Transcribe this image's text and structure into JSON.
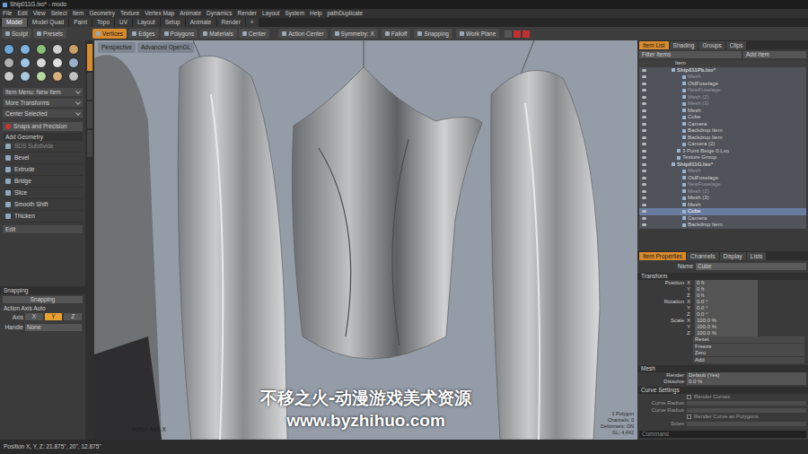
{
  "window": {
    "title": "Ship011G.lxo* - modo"
  },
  "menu": [
    "File",
    "Edit",
    "View",
    "Select",
    "Item",
    "Geometry",
    "Texture",
    "Vertex Map",
    "Animate",
    "Dynamics",
    "Render",
    "Layout",
    "System",
    "Help",
    "pathDuplicate"
  ],
  "layout_tabs": [
    {
      "label": "Model",
      "selected": true
    },
    {
      "label": "Model Quad",
      "selected": false
    },
    {
      "label": "Paint",
      "selected": false
    },
    {
      "label": "Topo",
      "selected": false
    },
    {
      "label": "UV",
      "selected": false
    },
    {
      "label": "Layout",
      "selected": false
    },
    {
      "label": "Setup",
      "selected": false
    },
    {
      "label": "Animate",
      "selected": false
    },
    {
      "label": "Render",
      "selected": false
    },
    {
      "label": "+",
      "selected": false
    }
  ],
  "toolbar": {
    "left": [
      "Sculpt",
      "Presets"
    ],
    "modes": [
      {
        "label": "Vertices",
        "selected": true
      },
      {
        "label": "Edges",
        "selected": false
      },
      {
        "label": "Polygons",
        "selected": false
      },
      {
        "label": "Materials",
        "selected": false
      },
      {
        "label": "Center",
        "selected": false
      }
    ],
    "options": [
      "Action Center",
      "Symmetry: X",
      "Falloff",
      "Snapping",
      "Work Plane"
    ]
  },
  "left_panel": {
    "dropdowns": [
      "Item Menu: New Item",
      "More Transforms",
      "Center Selected"
    ],
    "snaps_button": "Snaps and Precision",
    "add_geometry": "Add Geometry",
    "tools": [
      {
        "label": "SDS Subdivide",
        "disabled": true
      },
      {
        "label": "Bevel",
        "disabled": false
      },
      {
        "label": "Extrude",
        "disabled": false
      },
      {
        "label": "Bridge",
        "disabled": false
      },
      {
        "label": "Slice",
        "disabled": false
      },
      {
        "label": "Smooth Shift",
        "disabled": false
      },
      {
        "label": "Thicken",
        "disabled": false
      }
    ],
    "edit_dropdown": "Edit",
    "snapping": {
      "title": "Snapping",
      "field": "Snapping",
      "action_axis": "Action Axis Auto",
      "axis_label": "Axis",
      "axes": [
        {
          "label": "X",
          "selected": false
        },
        {
          "label": "Y",
          "selected": true
        },
        {
          "label": "Z",
          "selected": false
        }
      ],
      "handle_label": "Handle",
      "handle_value": "None"
    }
  },
  "viewport": {
    "tabs": [
      "Perspective",
      "Advanced OpenGL"
    ],
    "axis_label": "Action Axis X",
    "stats": [
      "1 Polygon",
      "Channels: 0",
      "Deformers: ON",
      "GL: 4,442"
    ]
  },
  "watermark": {
    "line1": "不移之火-动漫游戏美术资源",
    "line2": "www.byzhihuo.com"
  },
  "item_list": {
    "tabs": [
      {
        "label": "Item List",
        "selected": true
      },
      {
        "label": "Shading",
        "selected": false
      },
      {
        "label": "Groups",
        "selected": false
      },
      {
        "label": "Clips",
        "selected": false
      }
    ],
    "filter": "Filter Items",
    "add_item": "Add Item",
    "header": "Item",
    "rows": [
      {
        "label": "Ship011Pb.lxo*",
        "depth": 0,
        "dimmed": false,
        "selected": false,
        "bold": true
      },
      {
        "label": "Mesh",
        "depth": 2,
        "dimmed": true,
        "selected": false,
        "bold": false
      },
      {
        "label": "OldFuselage",
        "depth": 2,
        "dimmed": false,
        "selected": false,
        "bold": false
      },
      {
        "label": "NewFuselage",
        "depth": 2,
        "dimmed": true,
        "selected": false,
        "bold": false
      },
      {
        "label": "Mesh (2)",
        "depth": 2,
        "dimmed": true,
        "selected": false,
        "bold": false
      },
      {
        "label": "Mesh (3)",
        "depth": 2,
        "dimmed": true,
        "selected": false,
        "bold": false
      },
      {
        "label": "Mesh",
        "depth": 2,
        "dimmed": false,
        "selected": false,
        "bold": false
      },
      {
        "label": "Cube",
        "depth": 2,
        "dimmed": false,
        "selected": false,
        "bold": false
      },
      {
        "label": "Camera",
        "depth": 2,
        "dimmed": false,
        "selected": false,
        "bold": false
      },
      {
        "label": "Backdrop Item",
        "depth": 2,
        "dimmed": false,
        "selected": false,
        "bold": false
      },
      {
        "label": "Backdrop Item",
        "depth": 2,
        "dimmed": false,
        "selected": false,
        "bold": false
      },
      {
        "label": "Camera (2)",
        "depth": 2,
        "dimmed": false,
        "selected": false,
        "bold": false
      },
      {
        "label": "3 Point Beige 0.Lxo",
        "depth": 1,
        "dimmed": false,
        "selected": false,
        "bold": false
      },
      {
        "label": "Texture Group",
        "depth": 1,
        "dimmed": false,
        "selected": false,
        "bold": false
      },
      {
        "label": "Ship011G.lxo*",
        "depth": 0,
        "dimmed": false,
        "selected": false,
        "bold": true
      },
      {
        "label": "Mesh",
        "depth": 2,
        "dimmed": true,
        "selected": false,
        "bold": false
      },
      {
        "label": "OldFuselage",
        "depth": 2,
        "dimmed": false,
        "selected": false,
        "bold": false
      },
      {
        "label": "NewFuselage",
        "depth": 2,
        "dimmed": true,
        "selected": false,
        "bold": false
      },
      {
        "label": "Mesh (2)",
        "depth": 2,
        "dimmed": true,
        "selected": false,
        "bold": false
      },
      {
        "label": "Mesh (3)",
        "depth": 2,
        "dimmed": false,
        "selected": false,
        "bold": false
      },
      {
        "label": "Mesh",
        "depth": 2,
        "dimmed": false,
        "selected": false,
        "bold": false
      },
      {
        "label": "Cube",
        "depth": 2,
        "dimmed": false,
        "selected": true,
        "bold": false
      },
      {
        "label": "Camera",
        "depth": 2,
        "dimmed": false,
        "selected": false,
        "bold": false
      },
      {
        "label": "Backdrop Item",
        "depth": 2,
        "dimmed": false,
        "selected": false,
        "bold": false
      }
    ]
  },
  "properties": {
    "tabs": [
      {
        "label": "Item Properties",
        "selected": true
      },
      {
        "label": "Channels",
        "selected": false
      },
      {
        "label": "Display",
        "selected": false
      },
      {
        "label": "Lists",
        "selected": false
      }
    ],
    "name_label": "Name",
    "name_value": "Cube",
    "transform_title": "Transform",
    "transform": [
      {
        "group": "Position",
        "rows": [
          {
            "axis": "X",
            "value": "0 ft"
          },
          {
            "axis": "Y",
            "value": "0 ft"
          },
          {
            "axis": "Z",
            "value": "0 ft"
          }
        ]
      },
      {
        "group": "Rotation",
        "rows": [
          {
            "axis": "X",
            "value": "0.0 °"
          },
          {
            "axis": "Y",
            "value": "0.0 °"
          },
          {
            "axis": "Z",
            "value": "0.0 °"
          }
        ]
      },
      {
        "group": "Scale",
        "rows": [
          {
            "axis": "X",
            "value": "100.0 %"
          },
          {
            "axis": "Y",
            "value": "100.0 %"
          },
          {
            "axis": "Z",
            "value": "100.0 %"
          }
        ]
      }
    ],
    "transform_menus": [
      "Reset",
      "Freeze",
      "Zero",
      "Add"
    ],
    "mesh_title": "Mesh",
    "mesh": [
      {
        "label": "Render",
        "value": "Default (Yes)"
      },
      {
        "label": "Dissolve",
        "value": "0.0 %"
      }
    ],
    "curve_title": "Curve Settings",
    "curve": [
      {
        "label": "Render Curves",
        "kind": "check",
        "value": ""
      },
      {
        "label": "Curve Radius",
        "kind": "field",
        "value": ""
      },
      {
        "label": "Curve Radius",
        "kind": "field",
        "value": ""
      },
      {
        "label": "Render Curve as Polygons",
        "kind": "check",
        "value": ""
      },
      {
        "label": "Sides",
        "kind": "field",
        "value": ""
      }
    ],
    "command_placeholder": "Command"
  },
  "status_bar": "Position X, Y, Z:  21.875\", 20\", 12.875\""
}
